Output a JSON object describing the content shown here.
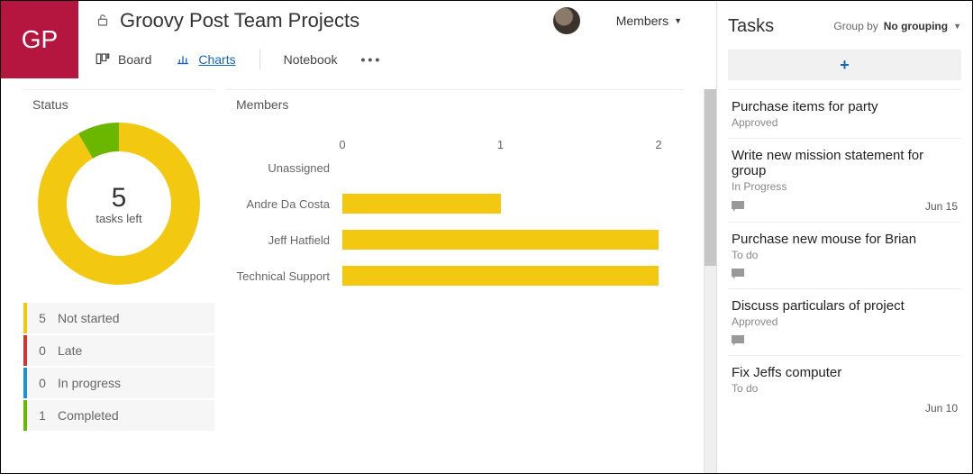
{
  "app_tile": "GP",
  "page_title": "Groovy Post Team Projects",
  "members_dropdown_label": "Members",
  "tabs": {
    "board": "Board",
    "charts": "Charts",
    "notebook": "Notebook"
  },
  "status_card": {
    "title": "Status",
    "center_number": "5",
    "center_label": "tasks left",
    "legend": {
      "not_started": {
        "count": "5",
        "label": "Not started",
        "color": "#f2c811"
      },
      "late": {
        "count": "0",
        "label": "Late",
        "color": "#d13438"
      },
      "in_progress": {
        "count": "0",
        "label": "In progress",
        "color": "#1f91d0"
      },
      "completed": {
        "count": "1",
        "label": "Completed",
        "color": "#6bb700"
      }
    }
  },
  "members_card": {
    "title": "Members"
  },
  "chart_data": {
    "type": "bar",
    "orientation": "horizontal",
    "xlabel": "",
    "ylabel": "",
    "xlim": [
      0,
      2
    ],
    "x_ticks": [
      0,
      1,
      2
    ],
    "categories": [
      "Unassigned",
      "Andre Da Costa",
      "Jeff Hatfield",
      "Technical Support"
    ],
    "values": [
      0,
      1,
      2,
      2
    ],
    "bar_color": "#f2c811"
  },
  "donut_data": {
    "type": "pie",
    "slices": [
      {
        "label": "Not started",
        "value": 5,
        "color": "#f2c811"
      },
      {
        "label": "Completed",
        "value": 1,
        "color": "#6bb700"
      }
    ],
    "center_number": 5,
    "center_label": "tasks left"
  },
  "right_panel": {
    "title": "Tasks",
    "group_by_label": "Group by",
    "group_by_value": "No grouping",
    "tasks": {
      "t0": {
        "title": "Purchase items for party",
        "status": "Approved",
        "has_comment": false,
        "date": ""
      },
      "t1": {
        "title": "Write new mission statement for group",
        "status": "In Progress",
        "has_comment": true,
        "date": "Jun 15"
      },
      "t2": {
        "title": "Purchase new mouse for Brian",
        "status": "To do",
        "has_comment": true,
        "date": ""
      },
      "t3": {
        "title": "Discuss particulars of project",
        "status": "Approved",
        "has_comment": true,
        "date": ""
      },
      "t4": {
        "title": "Fix Jeffs computer",
        "status": "To do",
        "has_comment": false,
        "date": "Jun 10"
      }
    }
  }
}
